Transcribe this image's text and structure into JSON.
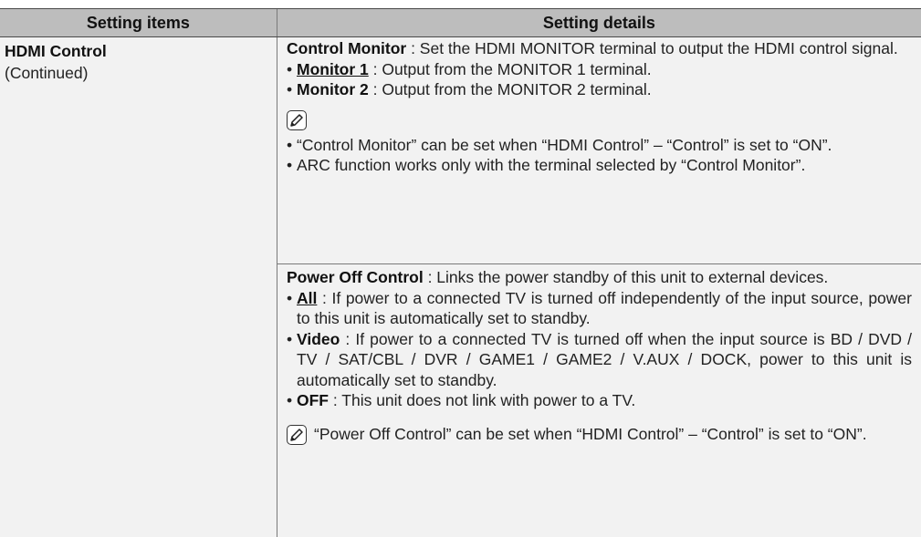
{
  "table": {
    "headers": [
      "Setting items",
      "Setting details"
    ],
    "item": {
      "title": "HDMI Control",
      "subtitle": "(Continued)"
    },
    "control_monitor": {
      "label": "Control Monitor",
      "desc": " : Set the HDMI MONITOR terminal to output the HDMI control signal.",
      "options": [
        {
          "name": "Monitor 1",
          "desc": " : Output from the MONITOR 1 terminal."
        },
        {
          "name": "Monitor 2",
          "desc": " : Output from the MONITOR 2 terminal."
        }
      ],
      "notes": [
        "“Control Monitor” can be set when “HDMI Control” – “Control” is set to “ON”.",
        "ARC function works only with the terminal selected by “Control Monitor”."
      ]
    },
    "power_off_control": {
      "label": "Power Off Control",
      "desc": " : Links the power standby of this unit to external devices.",
      "options": [
        {
          "name": "All",
          "desc": " : If power to a connected TV is turned off independently of the input source, power to this unit is automatically set to standby."
        },
        {
          "name": "Video",
          "desc": " : If power to a connected TV is turned off when the input source is BD / DVD / TV / SAT/CBL / DVR / GAME1 / GAME2 / V.AUX / DOCK, power to this unit is automatically set to standby."
        },
        {
          "name": "OFF",
          "desc": " : This unit does not link with power to a TV."
        }
      ],
      "note": "“Power Off Control” can be set when “HDMI Control” – “Control” is set to “ON”."
    }
  },
  "icons": {
    "note": "pencil-note-icon"
  },
  "colors": {
    "header_bg": "#bdbdbd",
    "row_bg": "#f2f2f2"
  }
}
